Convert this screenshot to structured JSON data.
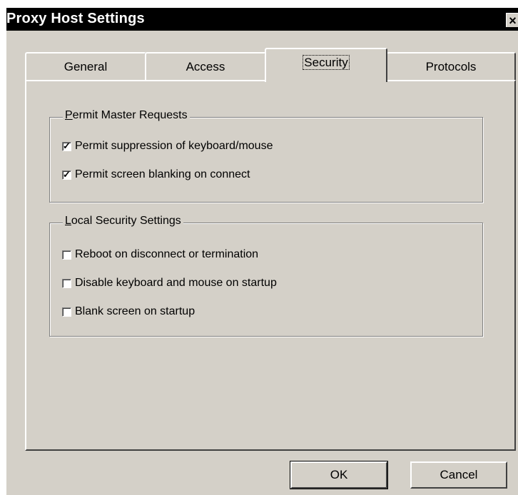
{
  "window": {
    "title": "Proxy Host Settings",
    "close_glyph": "×"
  },
  "tabs": [
    {
      "label": "General",
      "active": false
    },
    {
      "label": "Access",
      "active": false
    },
    {
      "label": "Security",
      "active": true
    },
    {
      "label": "Protocols",
      "active": false
    }
  ],
  "permit_master_requests": {
    "title": "Permit Master Requests",
    "mnemonic": "P",
    "items": [
      {
        "label": "Permit suppression of keyboard/mouse",
        "checked": true
      },
      {
        "label": "Permit screen blanking on connect",
        "checked": true
      }
    ]
  },
  "local_security_settings": {
    "title": "Local Security Settings",
    "mnemonic": "L",
    "items": [
      {
        "label": "Reboot on disconnect or termination",
        "checked": false
      },
      {
        "label": "Disable keyboard and mouse on startup",
        "checked": false
      },
      {
        "label": "Blank screen on startup",
        "checked": false
      }
    ]
  },
  "buttons": {
    "ok_label": "OK",
    "cancel_label": "Cancel"
  },
  "icons": {
    "close": "close-icon",
    "check": "checkmark-icon"
  },
  "colors": {
    "face": "#d4d0c8",
    "titlebar": "#000000",
    "highlight": "#ffffff",
    "shadow": "#404040"
  }
}
